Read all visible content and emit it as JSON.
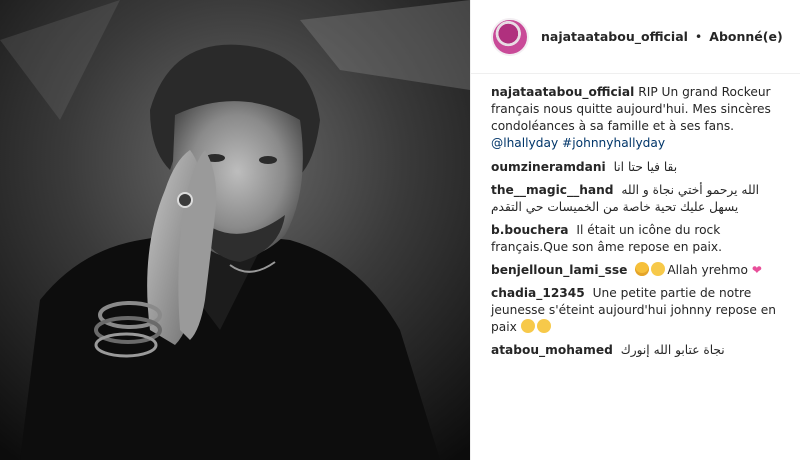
{
  "post": {
    "author": "najataatabou_official",
    "separator": "•",
    "follow_status": "Abonné(e)",
    "caption": {
      "user": "najataatabou_official",
      "text": "RIP Un grand Rockeur français nous quitte aujourd'hui. Mes sincères condoléances à sa famille et à ses fans.",
      "mention": "@lhallyday",
      "hashtag": "#johnnyhallyday"
    },
    "comments": [
      {
        "user": "oumzineramdani",
        "text": "بقا فيا حتا انا"
      },
      {
        "user": "the__magic__hand",
        "text": "الله يرحمو أختي نجاة و الله يسهل عليك تحية خاصة من الخميسات حي التقدم"
      },
      {
        "user": "b.bouchera",
        "text": "Il était un icône du rock français.Que son âme repose en paix."
      },
      {
        "user": "benjelloun_lami_sse",
        "text": "Allah yrehmo"
      },
      {
        "user": "chadia_12345",
        "text": "Une petite partie de notre jeunesse s'éteint aujourd'hui johnny repose en paix"
      },
      {
        "user": "atabou_mohamed",
        "text": "نجاة عتابو الله إنورك"
      }
    ]
  },
  "icons": {
    "avatar": "profile-avatar",
    "emoji_tired": "tired-face-emoji",
    "emoji_sad": "disappointed-face-emoji",
    "emoji_heart": "pink-heart-emoji"
  }
}
